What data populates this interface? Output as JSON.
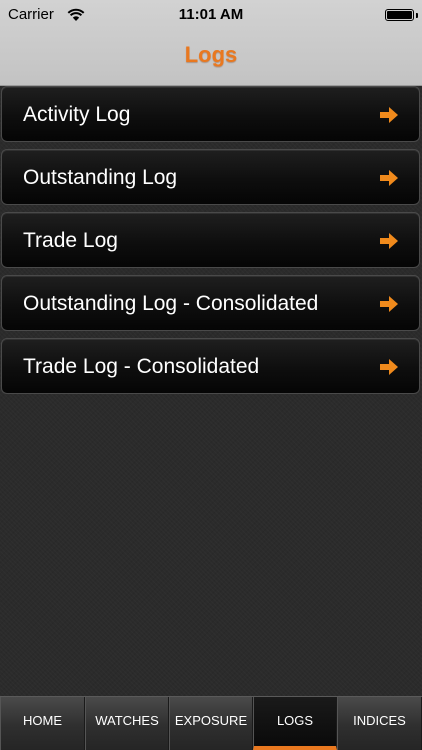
{
  "status_bar": {
    "carrier": "Carrier",
    "time": "11:01 AM"
  },
  "header": {
    "title": "Logs"
  },
  "rows": [
    {
      "label": "Activity Log",
      "icon": "arrow-right-icon"
    },
    {
      "label": "Outstanding Log",
      "icon": "arrow-right-icon"
    },
    {
      "label": "Trade Log",
      "icon": "arrow-right-icon"
    },
    {
      "label": "Outstanding Log - Consolidated",
      "icon": "arrow-right-icon"
    },
    {
      "label": "Trade Log - Consolidated",
      "icon": "arrow-right-icon"
    }
  ],
  "tabs": [
    {
      "label": "HOME",
      "active": false
    },
    {
      "label": "WATCHES",
      "active": false
    },
    {
      "label": "EXPOSURE",
      "active": false
    },
    {
      "label": "LOGS",
      "active": true
    },
    {
      "label": "INDICES",
      "active": false
    }
  ],
  "colors": {
    "accent": "#e9781f",
    "row_background": "#0e0e0e",
    "header_background": "#c8c8c8"
  }
}
